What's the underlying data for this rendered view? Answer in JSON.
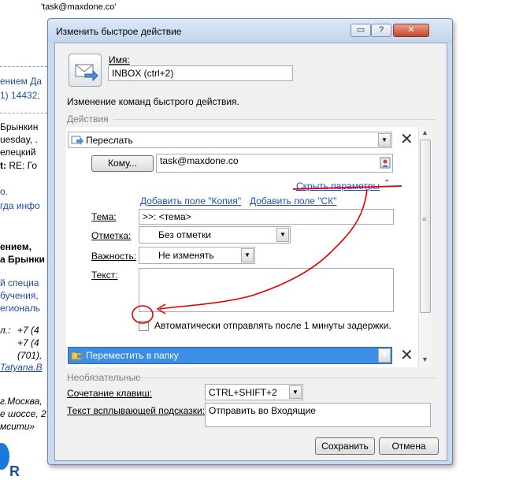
{
  "background": {
    "lines": [
      "'task@maxdone.co'",
      "ением Да",
      "1) 14432;",
      "Брынкин",
      "uesday, .",
      "елецкий",
      "RE: Го",
      "o.",
      "гда инфо",
      "ением,",
      "а Брынки",
      "й специа",
      "бучения,",
      "егиональ",
      "л.:",
      "+7 (4",
      "+7 (4",
      "(701),",
      "Tatyana.B",
      "г.Москва,",
      "е шоссе, 2",
      "мсити»",
      "R"
    ],
    "label_to": "t:"
  },
  "dialog": {
    "title": "Изменить быстрое действие",
    "name_label": "Имя:",
    "name_value": "INBOX (ctrl+2)",
    "description": "Изменение команд быстрого действия.",
    "actions_section": "Действия",
    "action1": {
      "value": "Переслать",
      "to_button": "Кому...",
      "to_value": "task@maxdone.co",
      "hide_options_link": "Скрыть параметры",
      "add_cc_link": "Добавить поле \"Копия\"",
      "add_bcc_link": "Добавить поле \"СК\"",
      "subject_label": "Тема:",
      "subject_value": ">>: <тема>",
      "flag_label": "Отметка:",
      "flag_value": "Без отметки",
      "importance_label": "Важность:",
      "importance_value": "Не изменять",
      "text_label": "Текст:",
      "text_value": "",
      "auto_send_label": "Автоматически отправлять после 1 минуты задержки.",
      "auto_send_checked": false
    },
    "action2": {
      "value": "Переместить в папку"
    },
    "optional_section": "Необязательные",
    "shortcut_label": "Сочетание клавиш:",
    "shortcut_value": "CTRL+SHIFT+2",
    "tooltip_label": "Текст всплывающей подсказки:",
    "tooltip_value": "Отправить во Входящие",
    "save_button": "Сохранить",
    "cancel_button": "Отмена"
  },
  "colors": {
    "link": "#1a4ec7",
    "selection": "#3a8ee6",
    "annotation": "#e00000"
  }
}
